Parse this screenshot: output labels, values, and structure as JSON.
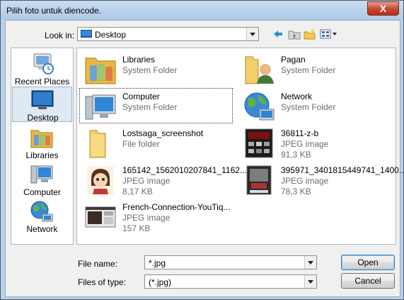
{
  "window": {
    "title": "Pilih foto untuk diencode.",
    "close_label": "X"
  },
  "toolbar": {
    "lookin_label": "Look in:",
    "lookin_value": "Desktop"
  },
  "places": [
    {
      "label": "Recent Places"
    },
    {
      "label": "Desktop"
    },
    {
      "label": "Libraries"
    },
    {
      "label": "Computer"
    },
    {
      "label": "Network"
    }
  ],
  "files": [
    {
      "name": "Libraries",
      "type": "System Folder",
      "size": ""
    },
    {
      "name": "Pagan",
      "type": "System Folder",
      "size": ""
    },
    {
      "name": "Computer",
      "type": "System Folder",
      "size": ""
    },
    {
      "name": "Network",
      "type": "System Folder",
      "size": ""
    },
    {
      "name": "Lostsaga_screenshot",
      "type": "File folder",
      "size": ""
    },
    {
      "name": "36811-z-b",
      "type": "JPEG image",
      "size": "91,3 KB"
    },
    {
      "name": "165142_1562010207841_1162...",
      "type": "JPEG image",
      "size": "8,17 KB"
    },
    {
      "name": "395971_3401815449741_1400...",
      "type": "JPEG image",
      "size": "78,3 KB"
    },
    {
      "name": "French-Connection-YouTiq...",
      "type": "JPEG image",
      "size": "157 KB"
    }
  ],
  "footer": {
    "filename_label": "File name:",
    "filename_value": "*.jpg",
    "filetype_label": "Files of type:",
    "filetype_value": "(*.jpg)",
    "open_label": "Open",
    "cancel_label": "Cancel"
  }
}
